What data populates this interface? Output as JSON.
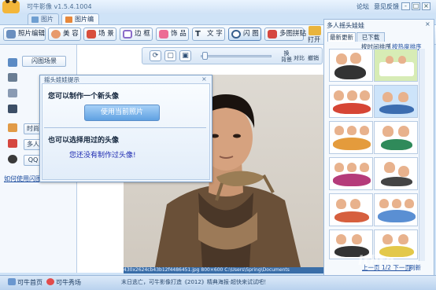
{
  "app": {
    "title": "可牛影像 v1.5.4.1004"
  },
  "title_links": {
    "forum": "论坛",
    "feedback": "意见反馈"
  },
  "window_controls": {
    "minimize": "-",
    "maximize": "□",
    "close": "×"
  },
  "tabs": [
    {
      "label": "图片库"
    },
    {
      "label": "图片编辑"
    }
  ],
  "toolbar": {
    "photo_edit": "照片编辑",
    "beauty": "美 容",
    "scene": "场 景",
    "frame": "边 框",
    "accessory": "饰 品",
    "text": "文 字",
    "flash": "闪 图",
    "multi_collage": "多图拼贴",
    "open": "打开"
  },
  "left_panel": {
    "buttons": [
      "闪图场景",
      "时尚",
      "多人",
      "QQ"
    ],
    "help_link": "如何使用闪图"
  },
  "canvas_toolbar": {
    "rotate": "⟳",
    "fit": "▢",
    "actual": "▣",
    "background_label": "换\n背景",
    "compare_label": "对比",
    "undo_label": "撤销",
    "redo_label": "重做"
  },
  "dialog": {
    "title": "摇头娃娃提示",
    "close": "×",
    "heading1": "您可以制作一个新头像",
    "use_current_photo": "使用当前照片",
    "heading2": "也可以选择用过的头像",
    "note": "您还没有制作过头像!"
  },
  "photo_info": "430x2624cb43b12f4486451.jpg    800×600    C:\\Users\\Spring\\Documents",
  "right_panel": {
    "title": "多人摇头娃娃",
    "close": "×",
    "tabs": [
      {
        "label": "最新更新"
      },
      {
        "label": "已下载"
      }
    ],
    "sort_time": "按时间排序",
    "sort_separator": "|",
    "sort_hot": "按热度排序",
    "pager": "上一页 1/2 下一页",
    "refresh": "刷新"
  },
  "status_bar": {
    "home": "可牛首页",
    "show": "可牛秀场",
    "center_text": "末日逃亡，可牛影像打造《2012》精典海报·超快来试试吧！"
  },
  "watermark": "Itlite",
  "colors": {
    "accent": "#5fa1e2",
    "dialog_note": "#1b28b0",
    "link": "#1f4fa0"
  }
}
